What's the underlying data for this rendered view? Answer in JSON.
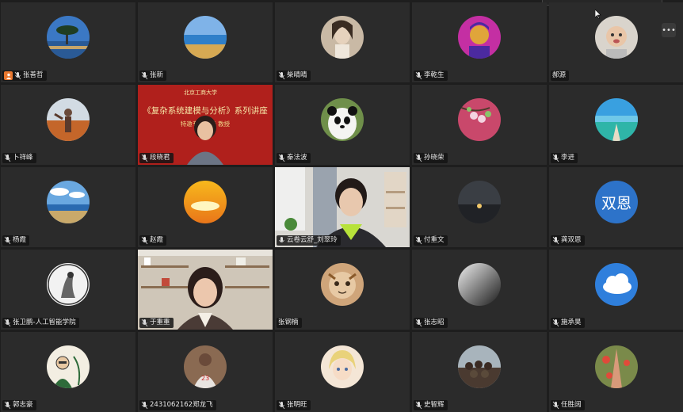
{
  "colors": {
    "speaking_border": "#2fbf5f",
    "host_badge": "#e8772e",
    "tile_bg": "#2b2b2b"
  },
  "participants": [
    {
      "name": "张善哲",
      "host": true
    },
    {
      "name": "张新"
    },
    {
      "name": "柴晴晴"
    },
    {
      "name": "李乾生"
    },
    {
      "name": "郝源"
    },
    {
      "name": "卜祥峰"
    },
    {
      "name": "段晓君"
    },
    {
      "name": "秦法波"
    },
    {
      "name": "孙晓荣"
    },
    {
      "name": "李进"
    },
    {
      "name": "杨霞"
    },
    {
      "name": "赵霞"
    },
    {
      "name": "云卷云舒_刘翠玲"
    },
    {
      "name": "付重文"
    },
    {
      "name": "龚双恩",
      "avatar_text": "双恩"
    },
    {
      "name": "张卫鹏-人工智能学院"
    },
    {
      "name": "于重重"
    },
    {
      "name": "张钢楠"
    },
    {
      "name": "张志昭"
    },
    {
      "name": "施承昊"
    },
    {
      "name": "郭志豪"
    },
    {
      "name": "2431062162郑龙飞"
    },
    {
      "name": "张明旺"
    },
    {
      "name": "史智辉"
    },
    {
      "name": "任胜阔"
    }
  ],
  "slide": {
    "logo_text": "北京工商大学",
    "title": "《复杂系统建模与分析》系列讲座",
    "subtitle": "特邀专家：段 教授"
  },
  "more_button_label": "•••"
}
